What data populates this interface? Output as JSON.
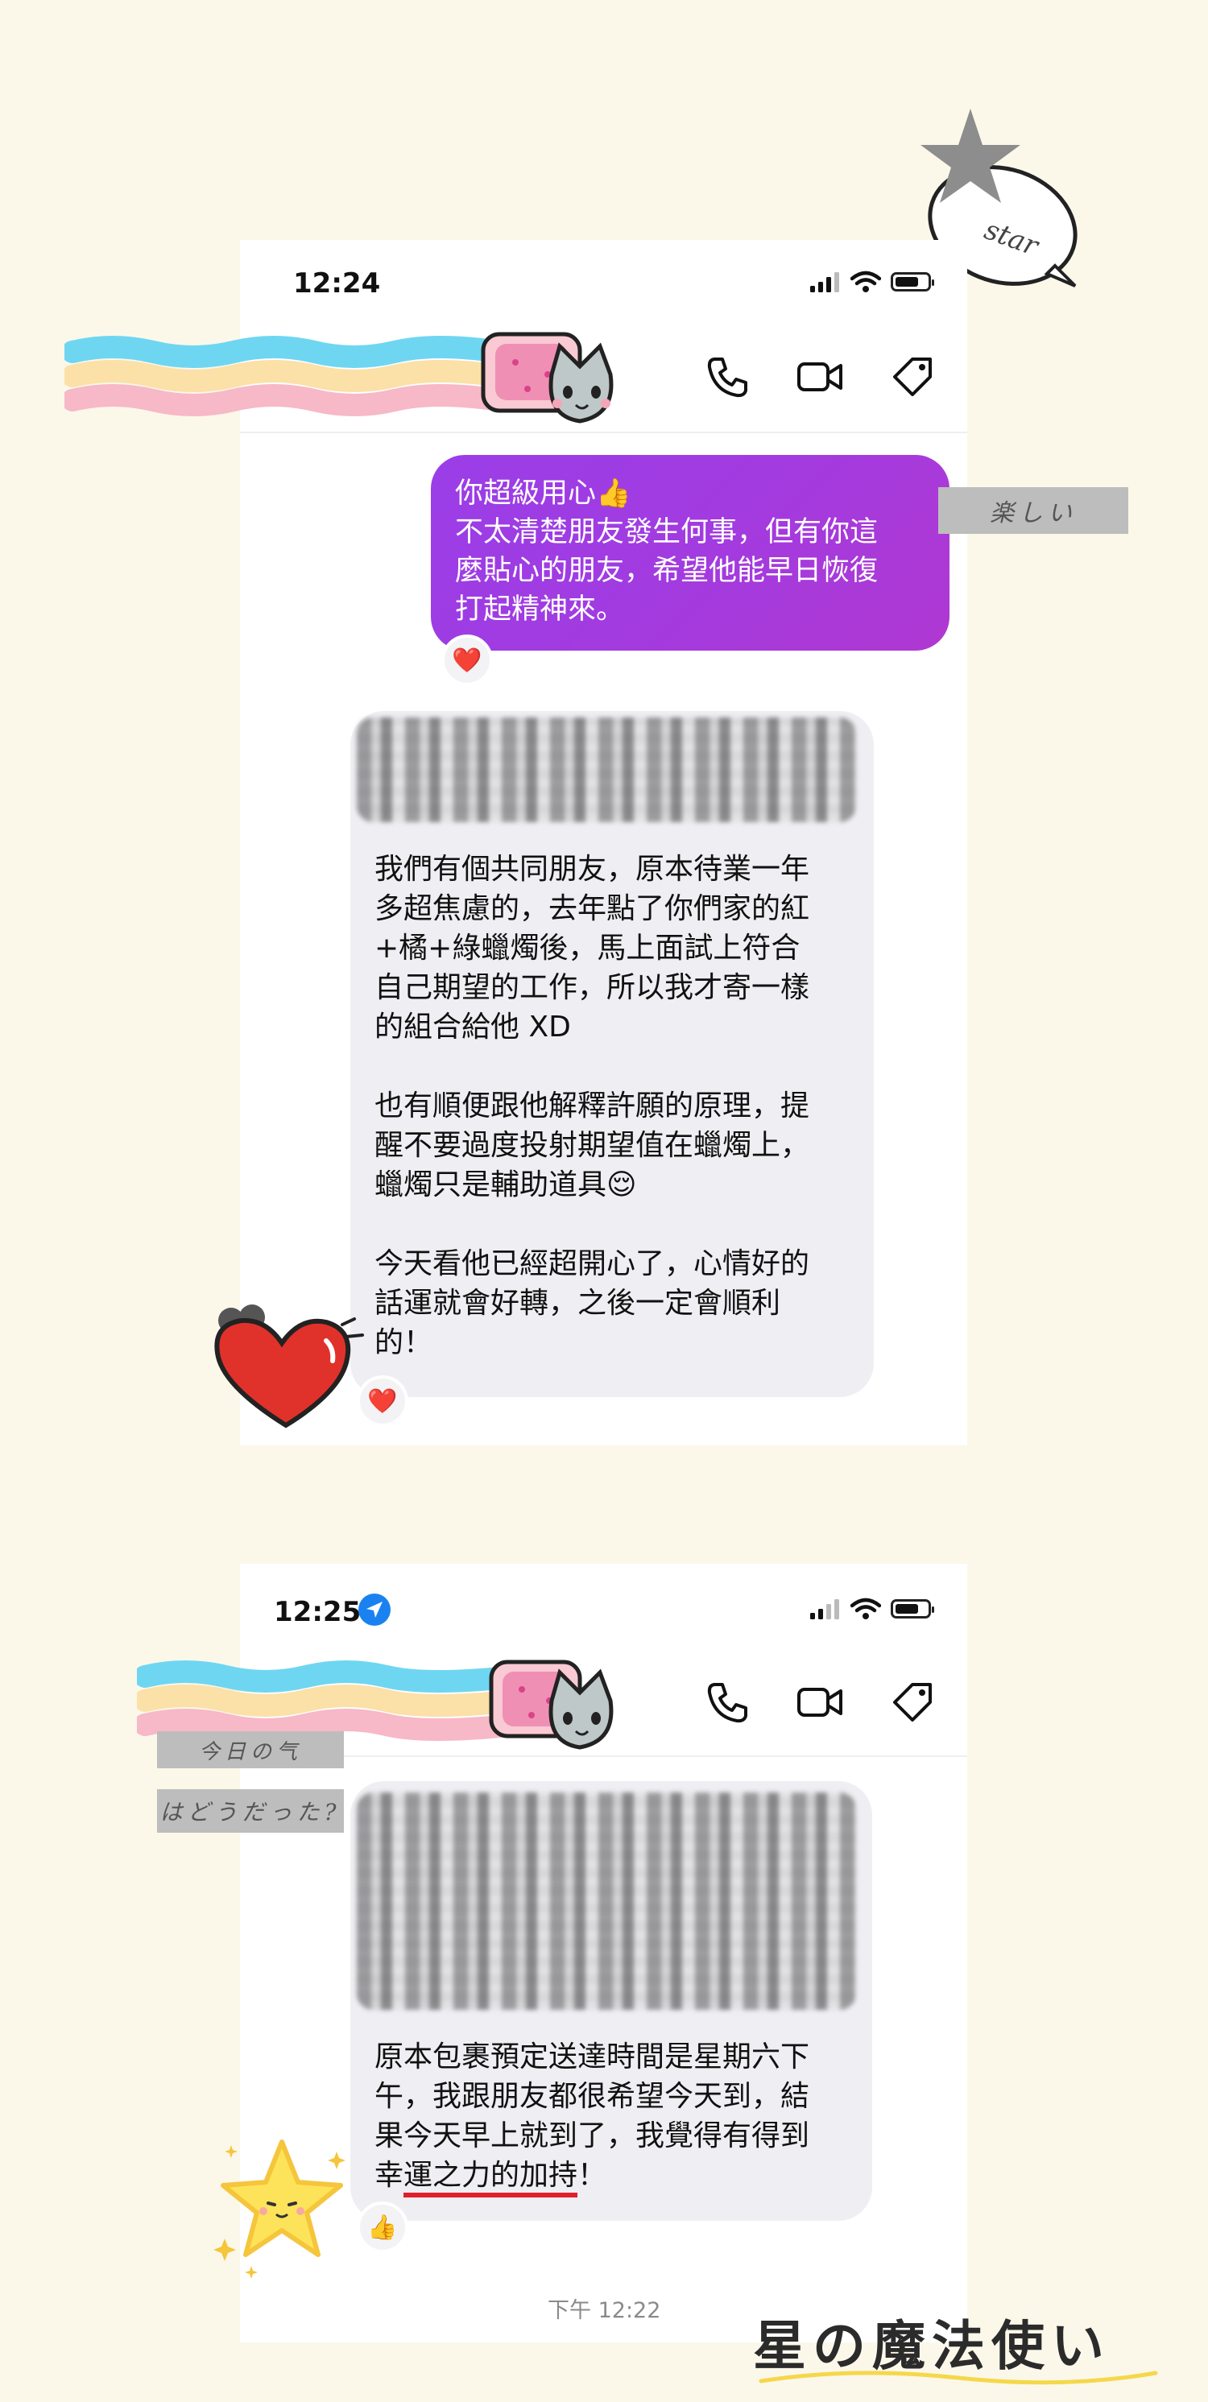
{
  "screenshot1": {
    "time": "12:24",
    "outgoing": {
      "line1": "你超級用心👍",
      "line2": "不太清楚朋友發生何事，但有你這",
      "line3": "麼貼心的朋友，希望他能早日恢復",
      "line4": "打起精神來。"
    },
    "outgoing_reaction": "❤️",
    "incoming": {
      "p1": [
        "我們有個共同朋友，原本待業一年",
        "多超焦慮的，去年點了你們家的紅",
        "+橘+綠蠟燭後，馬上面試上符合",
        "自己期望的工作，所以我才寄一樣",
        "的組合給他 XD"
      ],
      "p2": [
        "也有順便跟他解釋許願的原理，提",
        "醒不要過度投射期望值在蠟燭上，",
        "蠟燭只是輔助道具😌"
      ],
      "p3": [
        "今天看他已經超開心了，心情好的",
        "話運就會好轉，之後一定會順利",
        "的！"
      ]
    },
    "incoming_reaction": "❤️",
    "sticker_label": "楽しい"
  },
  "screenshot2": {
    "time": "12:25",
    "incoming": {
      "lines": [
        "原本包裹預定送達時間是星期六下",
        "午，我跟朋友都很希望今天到，結",
        "果今天早上就到了，我覺得有得到"
      ],
      "last_prefix": "幸",
      "last_underlined": "運之力的加持",
      "last_suffix": "！"
    },
    "incoming_reaction": "👍",
    "timestamp": "下午 12:22",
    "label1": "今日の气",
    "label2": "はどうだった?"
  },
  "decor": {
    "star_text": "star",
    "signature": "星の魔法使い"
  },
  "colors": {
    "background": "#fbf8ea",
    "bubble_purple": "#a23be0",
    "bubble_gray": "#efeff3",
    "heart_red": "#e0322b"
  }
}
